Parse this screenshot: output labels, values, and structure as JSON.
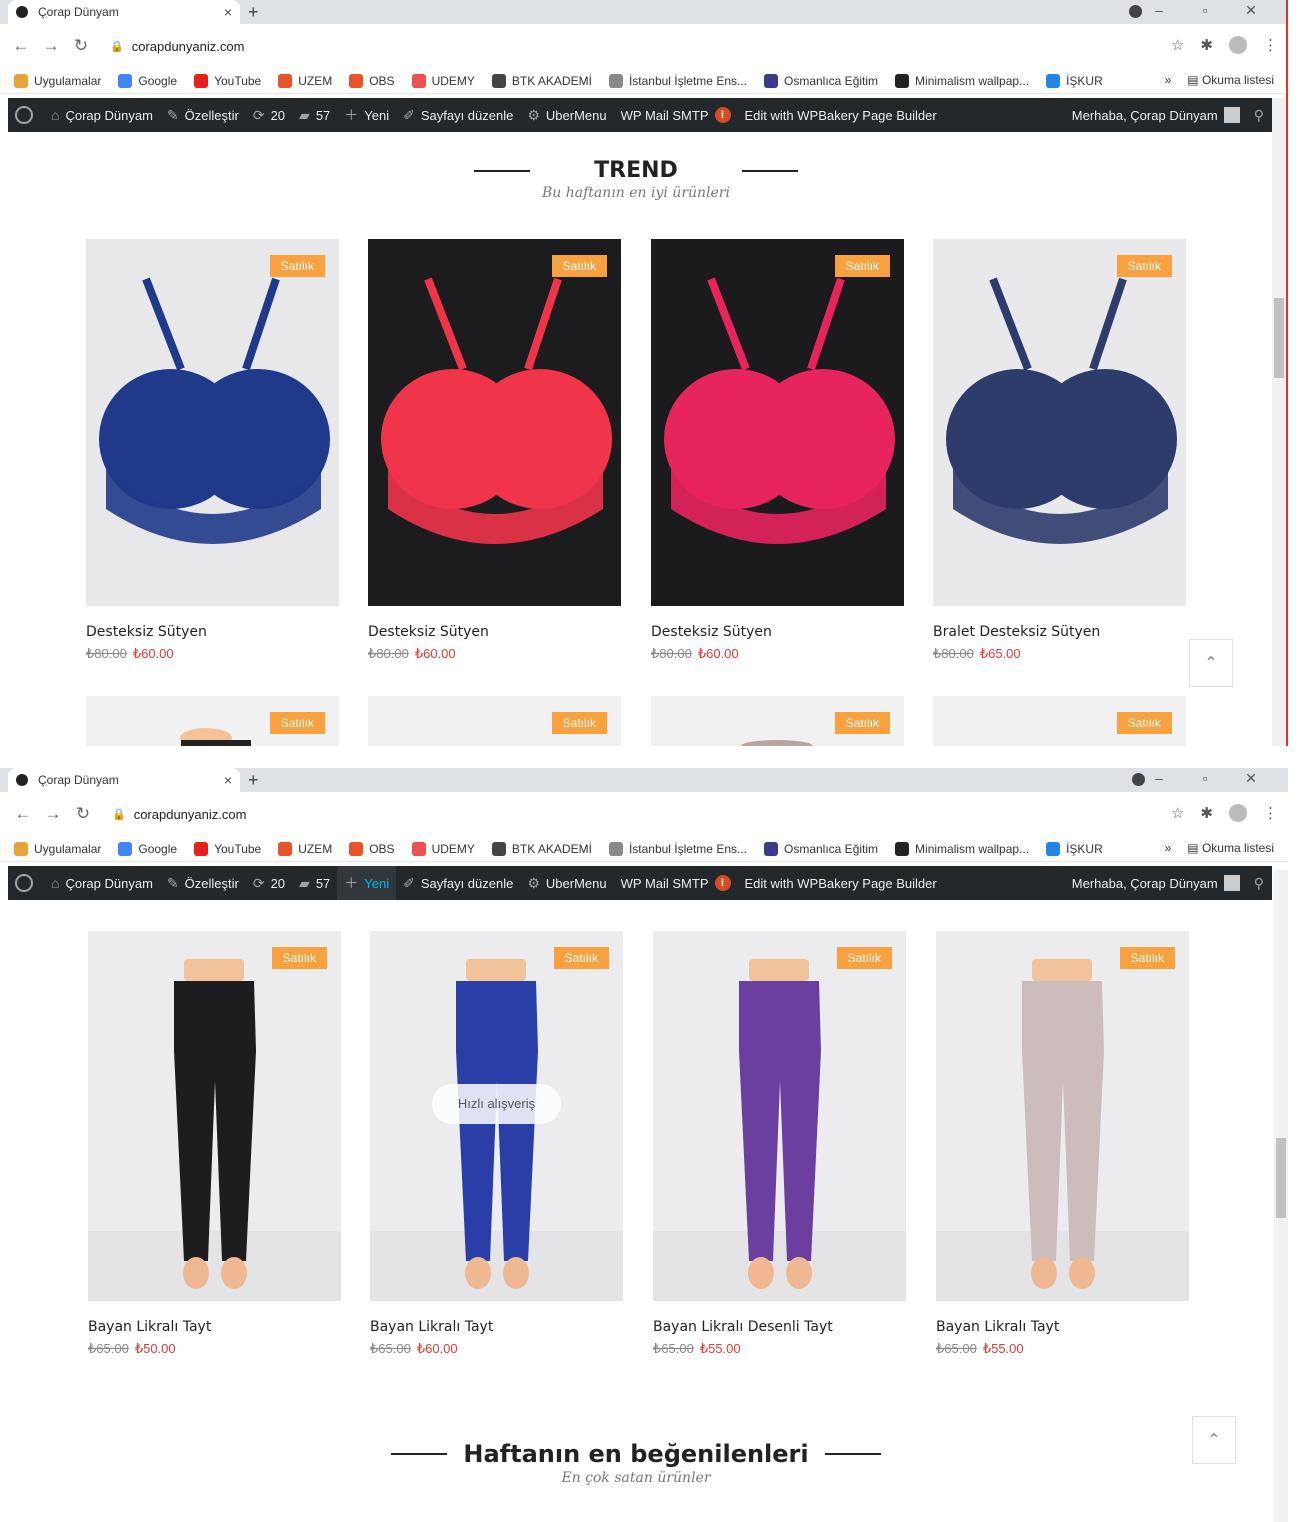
{
  "browser": {
    "tab_title": "Çorap Dünyam",
    "tab_close": "×",
    "new_tab": "+",
    "url": "corapdunyaniz.com",
    "bookmarks": [
      {
        "label": "Uygulamalar",
        "icon": "apps-grid-icon",
        "color": "#e8a33a"
      },
      {
        "label": "Google",
        "icon": "google-icon",
        "color": "#4285f4"
      },
      {
        "label": "YouTube",
        "icon": "youtube-icon",
        "color": "#e62117"
      },
      {
        "label": "UZEM",
        "icon": "uzem-icon",
        "color": "#e8542a"
      },
      {
        "label": "OBS",
        "icon": "obs-icon",
        "color": "#e8542a"
      },
      {
        "label": "UDEMY",
        "icon": "udemy-icon",
        "color": "#ec5252"
      },
      {
        "label": "BTK AKADEMİ",
        "icon": "btk-icon",
        "color": "#444444"
      },
      {
        "label": "İstanbul İşletme Ens...",
        "icon": "istanbul-icon",
        "color": "#888888"
      },
      {
        "label": "Osmanlıca Eğitim",
        "icon": "osmanlica-icon",
        "color": "#3b3a8f"
      },
      {
        "label": "Minimalism wallpap...",
        "icon": "wallpaper-icon",
        "color": "#222222"
      },
      {
        "label": "İŞKUR",
        "icon": "iskur-icon",
        "color": "#1e88e5"
      }
    ],
    "more_bookmarks": "»",
    "reading_list": "Okuma listesi"
  },
  "wp_admin_bar": {
    "site_name": "Çorap Dünyam",
    "customize": "Özelleştir",
    "updates_count": "20",
    "comments_count": "57",
    "new": "Yeni",
    "edit_page": "Sayfayı düzenle",
    "ubermenu": "UberMenu",
    "wp_mail_smtp": "WP Mail SMTP",
    "smtp_alert": "!",
    "wpbakery": "Edit with WPBakery Page Builder",
    "greeting": "Merhaba, Çorap Dünyam"
  },
  "trend_section": {
    "title": "TREND",
    "subtitle": "Bu haftanın en iyi ürünleri"
  },
  "badge_label": "Satılık",
  "trend_products": [
    {
      "name": "Desteksiz Sütyen",
      "old_price": "₺80.00",
      "new_price": "₺60.00",
      "color": "#1f3a8a",
      "bg": "#e8e8ea"
    },
    {
      "name": "Desteksiz Sütyen",
      "old_price": "₺80.00",
      "new_price": "₺60.00",
      "color": "#f0344a",
      "bg": "#1c1c1e"
    },
    {
      "name": "Desteksiz Sütyen",
      "old_price": "₺80.00",
      "new_price": "₺60.00",
      "color": "#e8245c",
      "bg": "#1b1b1d"
    },
    {
      "name": "Bralet Desteksiz Sütyen",
      "old_price": "₺80.00",
      "new_price": "₺65.00",
      "color": "#2d3c6b",
      "bg": "#e9e9ec"
    }
  ],
  "tayt_products": [
    {
      "name": "Bayan Likralı Tayt",
      "old_price": "₺65.00",
      "new_price": "₺50.00",
      "color": "#1d1d1f"
    },
    {
      "name": "Bayan Likralı Tayt",
      "old_price": "₺65.00",
      "new_price": "₺60.00",
      "color": "#2a3ea8"
    },
    {
      "name": "Bayan Likralı Desenli Tayt",
      "old_price": "₺65.00",
      "new_price": "₺55.00",
      "color": "#6b3fa0"
    },
    {
      "name": "Bayan Likralı Tayt",
      "old_price": "₺65.00",
      "new_price": "₺55.00",
      "color": "#cdbcbc"
    }
  ],
  "quick_shop_label": "Hızlı alışveriş",
  "liked_section": {
    "title": "Haftanın en beğenilenleri",
    "subtitle": "En çok satan ürünler"
  },
  "colors": {
    "badge": "#f9a03f",
    "sale_price": "#e53935",
    "admin_bar": "#23282d"
  }
}
